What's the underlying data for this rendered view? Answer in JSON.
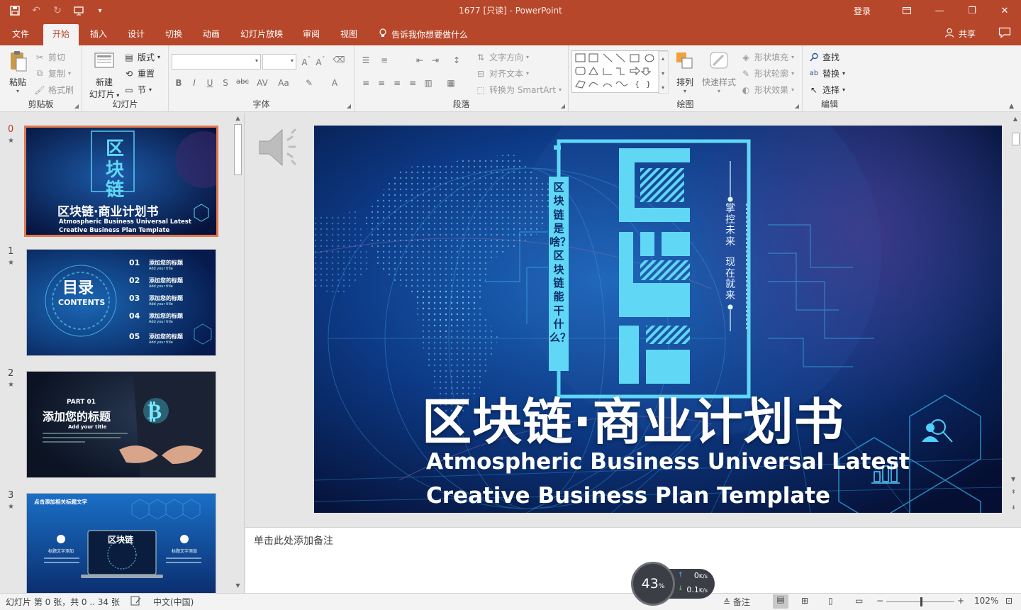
{
  "titlebar": {
    "title": "1677  [只读]  -  PowerPoint",
    "login": "登录",
    "qat_icons": [
      "save-icon",
      "undo-icon",
      "redo-icon",
      "present-from-start-icon",
      "customize-qat-icon"
    ]
  },
  "tabs": [
    "文件",
    "开始",
    "插入",
    "设计",
    "切换",
    "动画",
    "幻灯片放映",
    "审阅",
    "视图"
  ],
  "active_tab": "开始",
  "tellme": "告诉我你想要做什么",
  "share": "共享",
  "ribbon": {
    "clipboard": {
      "label": "剪贴板",
      "paste": "粘贴",
      "cut": "剪切",
      "copy": "复制",
      "format_painter": "格式刷"
    },
    "slides": {
      "label": "幻灯片",
      "new_slide": "新建\n幻灯片",
      "new_slide_l1": "新建",
      "new_slide_l2": "幻灯片",
      "layout": "版式",
      "reset": "重置",
      "section": "节"
    },
    "font": {
      "label": "字体",
      "buttons": [
        "B",
        "I",
        "U",
        "S",
        "abc",
        "AV",
        "Aa",
        "A"
      ]
    },
    "paragraph": {
      "label": "段落",
      "text_direction": "文字方向",
      "align_text": "对齐文本",
      "convert_smartart": "转换为 SmartArt"
    },
    "drawing": {
      "label": "绘图",
      "arrange": "排列",
      "quick_styles": "快速样式",
      "shape_fill": "形状填充",
      "shape_outline": "形状轮廓",
      "shape_effects": "形状效果"
    },
    "editing": {
      "label": "编辑",
      "find": "查找",
      "replace": "替换",
      "select": "选择"
    }
  },
  "thumbnails": [
    {
      "num": "0",
      "title": "区块链·商业计划书",
      "sub1": "Atmospheric Business Universal Latest",
      "sub2": "Creative Business Plan Template"
    },
    {
      "num": "1",
      "title": "目录",
      "sub": "CONTENTS",
      "items": [
        {
          "n": "01",
          "t": "添加您的标题",
          "s": "Add your title"
        },
        {
          "n": "02",
          "t": "添加您的标题",
          "s": "Add your title"
        },
        {
          "n": "03",
          "t": "添加您的标题",
          "s": "Add your title"
        },
        {
          "n": "04",
          "t": "添加您的标题",
          "s": "Add your title"
        },
        {
          "n": "05",
          "t": "添加您的标题",
          "s": "Add your title"
        }
      ]
    },
    {
      "num": "2",
      "part": "PART 01",
      "title": "添加您的标题",
      "sub": "Add your title"
    },
    {
      "num": "3",
      "title": "点击添加相关标题文字",
      "center": "区块链",
      "left": "标题文字添加",
      "right": "标题文字添加"
    }
  ],
  "slide": {
    "big_vertical": [
      "区",
      "块",
      "链"
    ],
    "left_vertical": "区块链是啥？区块链能干什么？",
    "right_vertical_1": "掌控未来",
    "right_vertical_2": "现在就来",
    "title": "区块链·商业计划书",
    "subtitle1": "Atmospheric Business Universal Latest",
    "subtitle2": "Creative Business Plan Template"
  },
  "notes_placeholder": "单击此处添加备注",
  "status": {
    "slide_info": "幻灯片 第 0 张，共 0 .. 34 张",
    "language": "中文(中国)",
    "notes": "备注",
    "zoom": "102%",
    "zoom_level": 0.51
  },
  "netwidget": {
    "percent": "43",
    "unit": "%",
    "up": "0",
    "up_unit": "K/s",
    "down": "0.1",
    "down_unit": "K/s"
  },
  "colors": {
    "accent": "#b7472a",
    "active_thumb_border": "#e2774f",
    "slide_cyan": "#5fd7f5"
  }
}
